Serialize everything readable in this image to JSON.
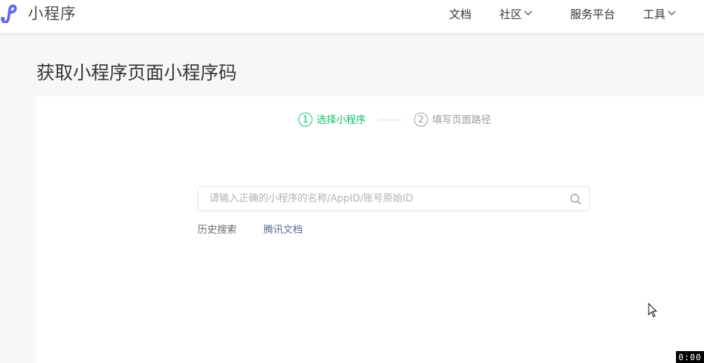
{
  "header": {
    "brand": "小程序",
    "nav": {
      "docs": "文档",
      "community": "社区",
      "service": "服务平台",
      "tools": "工具"
    }
  },
  "page": {
    "title": "获取小程序页面小程序码"
  },
  "steps": [
    {
      "number": "1",
      "label": "选择小程序",
      "state": "active"
    },
    {
      "number": "2",
      "label": "填写页面路径",
      "state": "inactive"
    }
  ],
  "search": {
    "placeholder": "请输入正确的小程序的名称/AppID/账号原始ID",
    "value": ""
  },
  "history": {
    "label": "历史搜索",
    "items": [
      "腾讯文档"
    ]
  },
  "recording": {
    "timer": "0:00"
  },
  "colors": {
    "accent": "#07c160",
    "link": "#576b95",
    "logo": "#6467f0"
  },
  "icons": {
    "logo": "miniprogram-logo-icon",
    "search": "search-icon",
    "dropdown": "chevron-down-icon",
    "cursor": "mouse-pointer-icon"
  }
}
